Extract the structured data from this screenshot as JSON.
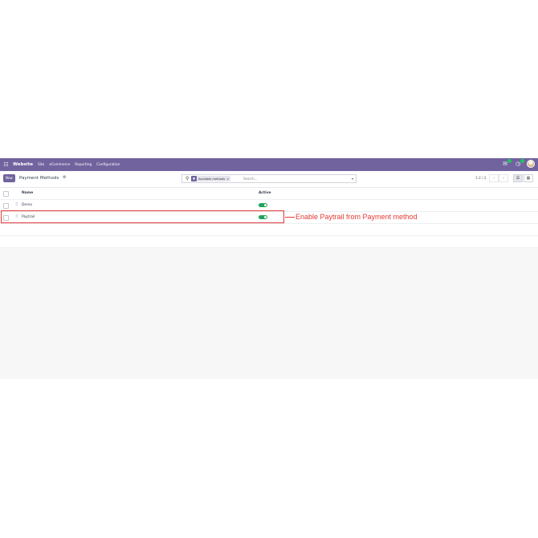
{
  "navbar": {
    "brand": "Website",
    "items": [
      "Site",
      "eCommerce",
      "Reporting",
      "Configuration"
    ],
    "icons": [
      "apps-grid-icon",
      "chat-icon",
      "activity-clock-icon",
      "user-avatar"
    ],
    "color": "#71639e"
  },
  "control": {
    "new_label": "New",
    "title": "Payment Methods",
    "search": {
      "facet_label": "Available methods",
      "placeholder": "Search..."
    },
    "pager": "1-2 / 2"
  },
  "list": {
    "headers": {
      "name": "Name",
      "active": "Active"
    },
    "rows": [
      {
        "name": "Demo",
        "active": true
      },
      {
        "name": "Paytrail",
        "active": true
      }
    ]
  },
  "annotation": {
    "text": "Enable Paytrail from Payment method",
    "color": "#e53935"
  }
}
